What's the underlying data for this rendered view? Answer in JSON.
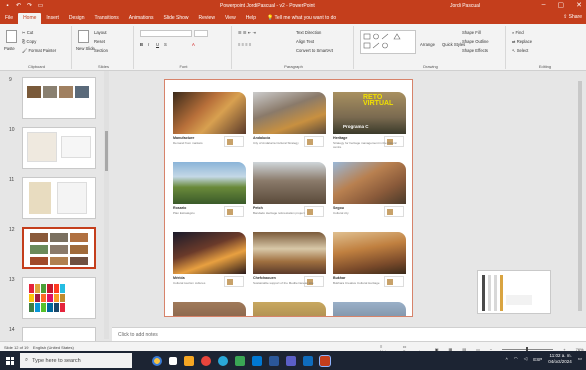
{
  "window": {
    "title": "Powerpoint JordiPascual - v2 - PowerPoint",
    "user": "Jordi Pascual",
    "colors": {
      "accent": "#c43e1c"
    }
  },
  "tabs": [
    "File",
    "Home",
    "Insert",
    "Design",
    "Transitions",
    "Animations",
    "Slide Show",
    "Review",
    "View",
    "Help"
  ],
  "tell_me": "Tell me what you want to do",
  "share": "Share",
  "ribbon": {
    "clipboard": {
      "label": "Clipboard",
      "cut": "Cut",
      "copy": "Copy",
      "paste": "Paste",
      "format_painter": "Format Painter"
    },
    "slides": {
      "label": "Slides",
      "new_slide": "New Slide",
      "layout": "Layout",
      "reset": "Reset",
      "section": "Section"
    },
    "font": {
      "label": "Font"
    },
    "paragraph": {
      "label": "Paragraph",
      "text_direction": "Text Direction",
      "align_text": "Align Text",
      "smartart": "Convert to SmartArt"
    },
    "drawing": {
      "label": "Drawing",
      "arrange": "Arrange",
      "quick_styles": "Quick Styles",
      "shape_fill": "Shape Fill",
      "shape_outline": "Shape Outline",
      "shape_effects": "Shape Effects"
    },
    "editing": {
      "label": "Editing",
      "find": "Find",
      "replace": "Replace",
      "select": "Select"
    }
  },
  "thumbnails": [
    {
      "number": "9"
    },
    {
      "number": "10"
    },
    {
      "number": "11"
    },
    {
      "number": "12"
    },
    {
      "number": "13"
    },
    {
      "number": "14"
    }
  ],
  "slide_cells": [
    {
      "title": "Manufacture",
      "subtitle": "Demand from markets"
    },
    {
      "title": "Andalucía",
      "subtitle": "City of Andalucía Cultural Strategy"
    },
    {
      "title": "Heritage",
      "subtitle": "Strategy for heritage management in the historic centre",
      "overlay": "RETO VIRTUAL",
      "overlay2": "Programa C"
    },
    {
      "title": "Rosario",
      "subtitle": "Plan Estratégico"
    },
    {
      "title": "Petch",
      "subtitle": "Bandado Heritage reforestation project"
    },
    {
      "title": "Segou",
      "subtitle": "Cultural city"
    },
    {
      "title": "Mérida",
      "subtitle": "Cultural tourism cultures"
    },
    {
      "title": "Chefchaouen",
      "subtitle": "Sustainable support of the Mediterranean site"
    },
    {
      "title": "Bukhar",
      "subtitle": "Bukhara Creative Cultural Heritage"
    },
    {
      "title": "",
      "subtitle": ""
    },
    {
      "title": "",
      "subtitle": ""
    },
    {
      "title": "",
      "subtitle": ""
    }
  ],
  "notes_placeholder": "Click to add notes",
  "status": {
    "slide_info": "Slide 12 of 19",
    "language": "English (United States)",
    "notes": "Notes",
    "comments": "Comments",
    "zoom": "76%"
  },
  "taskbar": {
    "search_placeholder": "Type here to search",
    "time": "11:02 a. m.",
    "date": "04/oct/2024",
    "lang": "ESP"
  }
}
